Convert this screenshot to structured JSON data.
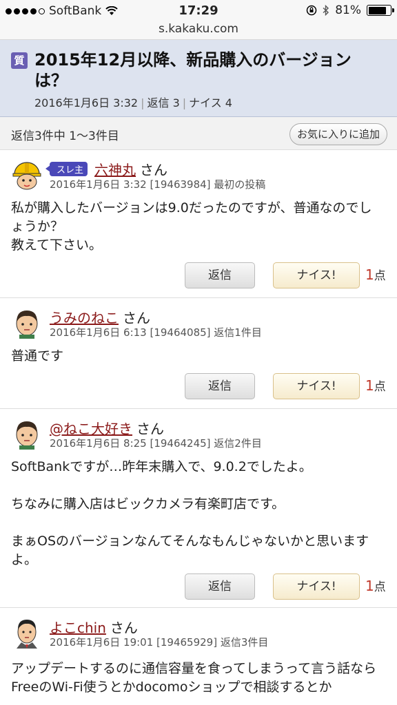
{
  "status_bar": {
    "carrier": "SoftBank",
    "time": "17:29",
    "battery": "81%",
    "battery_level": 0.81,
    "icons": [
      "signal-dots-icon",
      "wifi-icon",
      "rotation-lock-icon",
      "bluetooth-icon",
      "battery-icon"
    ]
  },
  "browser": {
    "url": "s.kakaku.com"
  },
  "thread": {
    "badge": "質",
    "title": "2015年12月以降、新品購入のバージョンは？",
    "date": "2016年1月6日 3:32",
    "replies": "返信 3",
    "nice": "ナイス 4"
  },
  "reply_bar": {
    "count_text": "返信3件中 1～3件目",
    "favorite_button": "お気に入りに追加"
  },
  "posts": [
    {
      "owner_badge": "スレ主",
      "author": "六神丸",
      "suffix": "さん",
      "meta": "2016年1月6日 3:32 [19463984] 最初の投稿",
      "body": "私が購入したバージョンは9.0だったのですが、普通なのでしょうか？\n教えて下さい。",
      "reply_label": "返信",
      "nice_label": "ナイス!",
      "nice_count": "1",
      "nice_unit": "点"
    },
    {
      "author": "うみのねこ",
      "suffix": "さん",
      "meta": "2016年1月6日 6:13 [19464085] 返信1件目",
      "body": "普通です",
      "reply_label": "返信",
      "nice_label": "ナイス!",
      "nice_count": "1",
      "nice_unit": "点"
    },
    {
      "author": "@ねこ大好き",
      "suffix": "さん",
      "meta": "2016年1月6日 8:25 [19464245] 返信2件目",
      "body": "SoftBankですが…昨年末購入で、9.0.2でしたよ。\n\nちなみに購入店はビックカメラ有楽町店です。\n\nまぁOSのバージョンなんてそんなもんじゃないかと思いますよ。",
      "reply_label": "返信",
      "nice_label": "ナイス!",
      "nice_count": "1",
      "nice_unit": "点"
    },
    {
      "author": "よこchin",
      "suffix": "さん",
      "meta": "2016年1月6日 19:01 [19465929] 返信3件目",
      "body": "アップデートするのに通信容量を食ってしまうって言う話なら\nFreeのWi-Fi使うとかdocomoショップで相談するとか"
    }
  ]
}
